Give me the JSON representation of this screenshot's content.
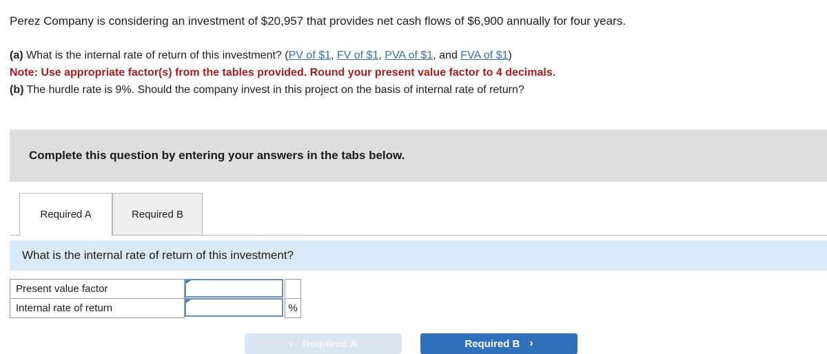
{
  "problem": {
    "stem_before_amount": "Perez Company is considering an investment of ",
    "investment_amount": "$20,957",
    "stem_middle": " that provides net cash flows of ",
    "cash_flow_amount": "$6,900",
    "stem_after": " annually for four years.",
    "full_stem": "Perez Company is considering an investment of $20,957 that provides net cash flows of $6,900 annually for four years.",
    "part_a_tag": "(a)",
    "part_a_text": " What is the internal rate of return of this investment? (",
    "part_a_links": [
      {
        "label": "PV of $1",
        "after": ", "
      },
      {
        "label": "FV of $1",
        "after": ", "
      },
      {
        "label": "PVA of $1",
        "after": ", and "
      },
      {
        "label": "FVA of $1",
        "after": ")"
      }
    ],
    "note": "Note: Use appropriate factor(s) from the tables provided. Round your present value factor to 4 decimals.",
    "part_b_tag": "(b)",
    "part_b_text": " The hurdle rate is 9%. Should the company invest in this project on the basis of internal rate of return?"
  },
  "instruction_panel": {
    "text": "Complete this question by entering your answers in the tabs below."
  },
  "tabs": [
    {
      "label": "Required A",
      "active": true
    },
    {
      "label": "Required B",
      "active": false
    }
  ],
  "question_bar": {
    "text": "What is the internal rate of return of this investment?"
  },
  "answer_table": {
    "rows": [
      {
        "label": "Present value factor",
        "value": "",
        "unit": ""
      },
      {
        "label": "Internal rate of return",
        "value": "",
        "unit": "%"
      }
    ]
  },
  "nav": {
    "prev_label": "Required A",
    "prev_chevron": "‹",
    "next_label": "Required B",
    "next_chevron": "›"
  },
  "colors": {
    "link": "#3a6ea5",
    "note_red": "#a21f24",
    "panel_gray": "#dededf",
    "question_blue": "#dbeaf7",
    "button_blue": "#3070b8",
    "button_disabled": "#dce5f2",
    "input_border": "#6d91b4"
  }
}
